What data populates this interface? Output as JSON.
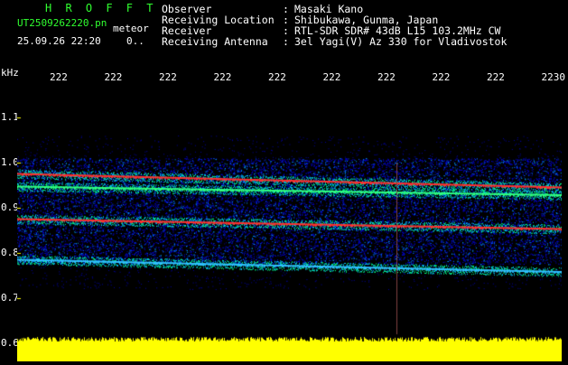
{
  "header": {
    "app_name": "H R O F F T",
    "filename": "UT2509262220.pn",
    "file_type": "meteor",
    "datetime": "25.09.26 22:20",
    "counter": "0..",
    "info": [
      {
        "label": "Observer",
        "sep": ":",
        "value": "Masaki Kano"
      },
      {
        "label": "Receiving Location",
        "sep": ":",
        "value": "Shibukawa, Gunma, Japan"
      },
      {
        "label": "Receiver",
        "sep": ":",
        "value": "RTL-SDR SDR# 43dB L15 103.2MHz CW"
      },
      {
        "label": "Receiving Antenna",
        "sep": ":",
        "value": "3el Yagi(V) Az 330 for Vladivostok"
      }
    ]
  },
  "chart_data": {
    "type": "heatmap",
    "ylabel": "kHz",
    "y_ticks": [
      "1.1",
      "1.0",
      "0.9",
      "0.8",
      "0.7",
      "0.6"
    ],
    "x_ticks": [
      "222",
      "222",
      "222",
      "222",
      "222",
      "222",
      "222",
      "222",
      "222",
      "2230"
    ],
    "traces": [
      {
        "y_start": 0.975,
        "y_end": 0.945,
        "color": "#ff3030"
      },
      {
        "y_start": 0.947,
        "y_end": 0.928,
        "color": "#30ff80"
      },
      {
        "y_start": 0.875,
        "y_end": 0.853,
        "color": "#ff3030"
      },
      {
        "y_start": 0.785,
        "y_end": 0.758,
        "color": "#30c0ff"
      }
    ],
    "colors": {
      "background": "#000000",
      "noise": "#0000ff",
      "grid": "#ffff00",
      "level": "#ffff00"
    }
  }
}
